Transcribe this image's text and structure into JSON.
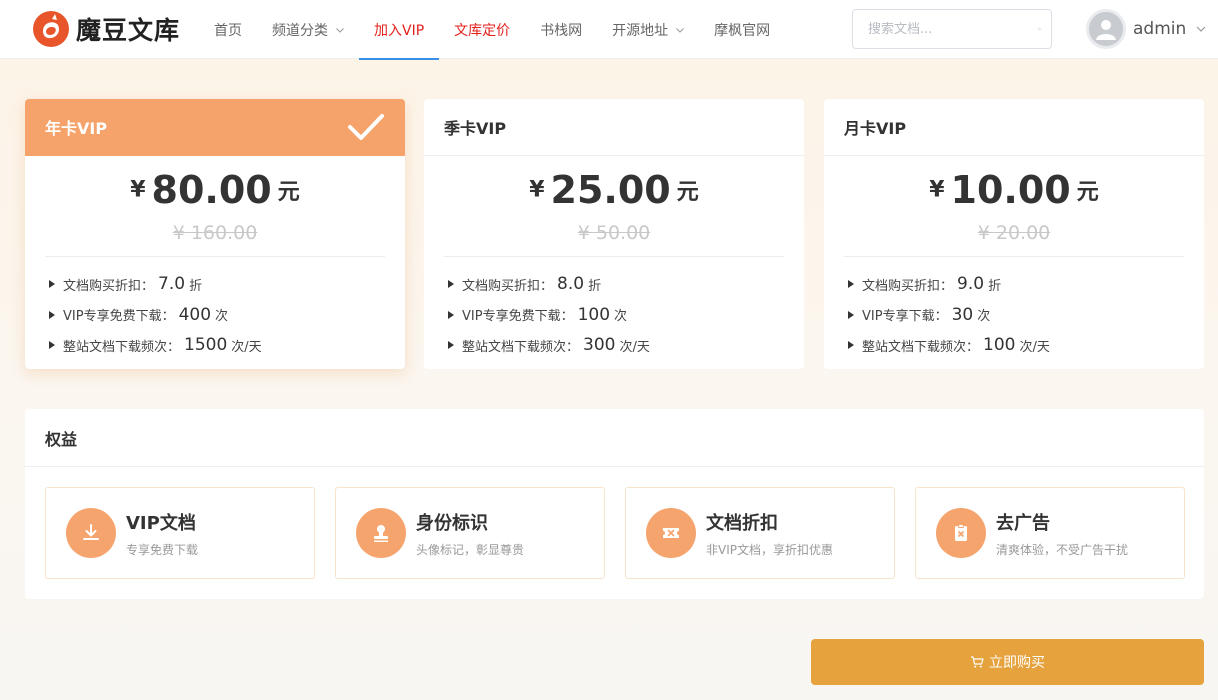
{
  "logo": {
    "text": "魔豆文库",
    "accent": "#e8552b"
  },
  "nav": [
    {
      "label": "首页"
    },
    {
      "label": "频道分类"
    },
    {
      "label": "加入VIP"
    },
    {
      "label": "文库定价"
    },
    {
      "label": "书栈网"
    },
    {
      "label": "开源地址"
    },
    {
      "label": "摩枫官网"
    }
  ],
  "search": {
    "placeholder": "搜索文档...",
    "value": ""
  },
  "user": {
    "name": "admin"
  },
  "plans": [
    {
      "title": "年卡VIP",
      "selected": true,
      "currency": "¥",
      "price": "80.00",
      "unit": "元",
      "original_price": "¥ 160.00",
      "features": [
        {
          "label": "文档购买折扣：",
          "value": "7.0",
          "suffix": "折"
        },
        {
          "label": "VIP专享免费下载：",
          "value": "400",
          "suffix": "次"
        },
        {
          "label": "整站文档下载频次：",
          "value": "1500",
          "suffix": "次/天"
        }
      ]
    },
    {
      "title": "季卡VIP",
      "selected": false,
      "currency": "¥",
      "price": "25.00",
      "unit": "元",
      "original_price": "¥ 50.00",
      "features": [
        {
          "label": "文档购买折扣：",
          "value": "8.0",
          "suffix": "折"
        },
        {
          "label": "VIP专享免费下载：",
          "value": "100",
          "suffix": "次"
        },
        {
          "label": "整站文档下载频次：",
          "value": "300",
          "suffix": "次/天"
        }
      ]
    },
    {
      "title": "月卡VIP",
      "selected": false,
      "currency": "¥",
      "price": "10.00",
      "unit": "元",
      "original_price": "¥ 20.00",
      "features": [
        {
          "label": "文档购买折扣：",
          "value": "9.0",
          "suffix": "折"
        },
        {
          "label": "VIP专享下载：",
          "value": "30",
          "suffix": "次"
        },
        {
          "label": "整站文档下载频次：",
          "value": "100",
          "suffix": "次/天"
        }
      ]
    }
  ],
  "benefits": {
    "title": "权益",
    "items": [
      {
        "title": "VIP文档",
        "desc": "专享免费下载",
        "icon": "download-icon"
      },
      {
        "title": "身份标识",
        "desc": "头像标记，彰显尊贵",
        "icon": "stamp-icon"
      },
      {
        "title": "文档折扣",
        "desc": "非VIP文档，享折扣优惠",
        "icon": "ticket-icon"
      },
      {
        "title": "去广告",
        "desc": "清爽体验，不受广告干扰",
        "icon": "no-ads-icon"
      }
    ]
  },
  "buy_button": {
    "label": "立即购买",
    "icon": "cart-icon"
  },
  "colors": {
    "selected_header": "#f6a36b",
    "benefit_icon": "#f5a46d",
    "buy_button": "#e6a23c",
    "active_red": "#e3201c"
  }
}
